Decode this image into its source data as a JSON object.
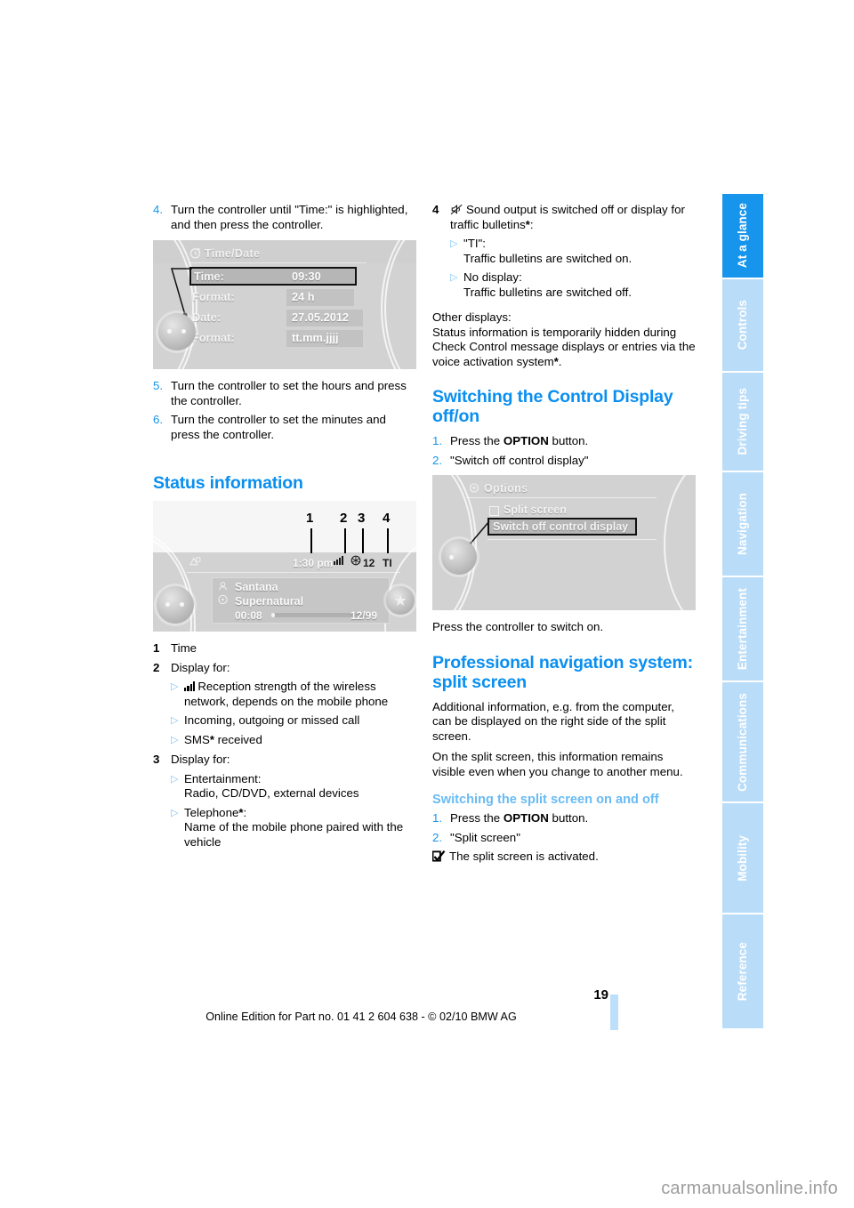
{
  "document": {
    "page_number": "19",
    "footer_text": "Online Edition for Part no. 01 41 2 604 638 - © 02/10 BMW AG",
    "watermark": "carmanualsonline.info"
  },
  "sidebar": {
    "tabs": [
      {
        "label": "At a glance",
        "active": true
      },
      {
        "label": "Controls",
        "active": false
      },
      {
        "label": "Driving tips",
        "active": false
      },
      {
        "label": "Navigation",
        "active": false
      },
      {
        "label": "Entertainment",
        "active": false
      },
      {
        "label": "Communications",
        "active": false
      },
      {
        "label": "Mobility",
        "active": false
      },
      {
        "label": "Reference",
        "active": false
      }
    ]
  },
  "left_column": {
    "step4": {
      "num": "4.",
      "text": "Turn the controller until \"Time:\" is highlighted, and then press the controller."
    },
    "timedate_screen": {
      "title": "Time/Date",
      "rows": [
        {
          "label": "Time:",
          "value": "09:30",
          "selected": true
        },
        {
          "label": "Format:",
          "value": "24 h",
          "selected": false
        },
        {
          "label": "Date:",
          "value": "27.05.2012",
          "selected": false
        },
        {
          "label": "Format:",
          "value": "tt.mm.jjjj",
          "selected": false
        }
      ]
    },
    "step5": {
      "num": "5.",
      "text": "Turn the controller to set the hours and press the controller."
    },
    "step6": {
      "num": "6.",
      "text": "Turn the controller to set the minutes and press the controller."
    },
    "status_heading": "Status information",
    "status_screen": {
      "callouts": [
        "1",
        "2",
        "3",
        "4"
      ],
      "status_bar": {
        "time": "1:30 pm",
        "temperature": "12",
        "ti": "TI"
      },
      "track": {
        "artist": "Santana",
        "album": "Supernatural",
        "elapsed": "00:08",
        "track_count": "12/99"
      }
    },
    "legend": [
      {
        "num": "1",
        "text": "Time"
      },
      {
        "num": "2",
        "text": "Display for:"
      },
      {
        "num": "3",
        "text": "Display for:"
      }
    ],
    "item2_bullets": [
      {
        "icon": "signal-bars-icon",
        "text": "Reception strength of the wireless network, depends on the mobile phone"
      },
      {
        "icon": "",
        "text": "Incoming, outgoing or missed call"
      },
      {
        "icon": "",
        "text": "SMS* received"
      }
    ],
    "item3_bullets": [
      {
        "icon": "",
        "text": "Entertainment:\nRadio, CD/DVD, external devices"
      },
      {
        "icon": "",
        "text": "Telephone*:\nName of the mobile phone paired with the vehicle"
      }
    ]
  },
  "right_column": {
    "item4": {
      "num": "4",
      "icon": "mute-speaker-icon",
      "text": "Sound output is switched off or display for traffic bulletins*:"
    },
    "item4_bullets": [
      {
        "text": "\"TI\":\nTraffic bulletins are switched on."
      },
      {
        "text": "No display:\nTraffic bulletins are switched off."
      }
    ],
    "other_displays": {
      "lead": "Other displays:",
      "body": "Status information is temporarily hidden during Check Control message displays or entries via the voice activation system*."
    },
    "control_display": {
      "heading": "Switching the Control Display off/on",
      "steps": [
        {
          "num": "1.",
          "pre": "Press the ",
          "bold": "OPTION",
          "post": " button."
        },
        {
          "num": "2.",
          "pre": "\"Switch off control display\"",
          "bold": "",
          "post": ""
        }
      ],
      "options_screen": {
        "title": "Options",
        "items": [
          {
            "label": "Split screen",
            "checkbox": true,
            "selected": false
          },
          {
            "label": "Switch off control display",
            "checkbox": false,
            "selected": true
          }
        ]
      },
      "after_text": "Press the controller to switch on."
    },
    "split_screen": {
      "heading": "Professional navigation system: split screen",
      "paragraphs": [
        "Additional information, e.g. from the computer, can be displayed on the right side of the split screen.",
        "On the split screen, this information remains visible even when you change to another menu."
      ],
      "subheading": "Switching the split screen on and off",
      "steps": [
        {
          "num": "1.",
          "pre": "Press the ",
          "bold": "OPTION",
          "post": " button."
        },
        {
          "num": "2.",
          "pre": "\"Split screen\"",
          "bold": "",
          "post": ""
        }
      ],
      "note": {
        "icon": "checkbox-checked-icon",
        "text": "The split screen is activated."
      }
    }
  },
  "colors": {
    "accent_blue": "#0a8ff0",
    "tab_active": "#1795ec",
    "tab_inactive": "#b9dcf8",
    "subheading_blue": "#69bbf4",
    "bullet_blue": "#7ec4f6"
  }
}
